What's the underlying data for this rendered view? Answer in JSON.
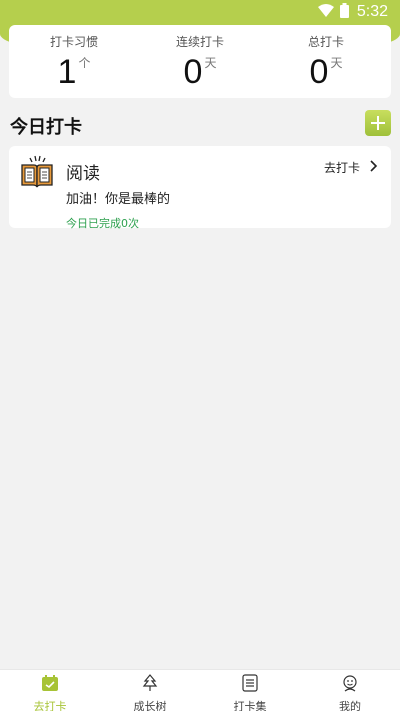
{
  "status_bar": {
    "time": "5:32",
    "icons": [
      "wifi-icon",
      "battery-icon"
    ]
  },
  "stats": [
    {
      "label": "打卡习惯",
      "value": "1",
      "unit": "个"
    },
    {
      "label": "连续打卡",
      "value": "0",
      "unit": "天"
    },
    {
      "label": "总打卡",
      "value": "0",
      "unit": "天"
    }
  ],
  "section": {
    "title": "今日打卡"
  },
  "habit": {
    "name": "阅读",
    "action_label": "去打卡",
    "motto": "加油！你是最棒的",
    "completed_text": "今日已完成0次",
    "icon": "book-icon"
  },
  "nav": [
    {
      "label": "去打卡",
      "icon": "calendar-icon",
      "active": true
    },
    {
      "label": "成长树",
      "icon": "tree-icon",
      "active": false
    },
    {
      "label": "打卡集",
      "icon": "list-icon",
      "active": false
    },
    {
      "label": "我的",
      "icon": "profile-icon",
      "active": false
    }
  ],
  "colors": {
    "accent": "#b5cf4d",
    "success": "#2ea04f",
    "background": "#f2f2f2"
  }
}
